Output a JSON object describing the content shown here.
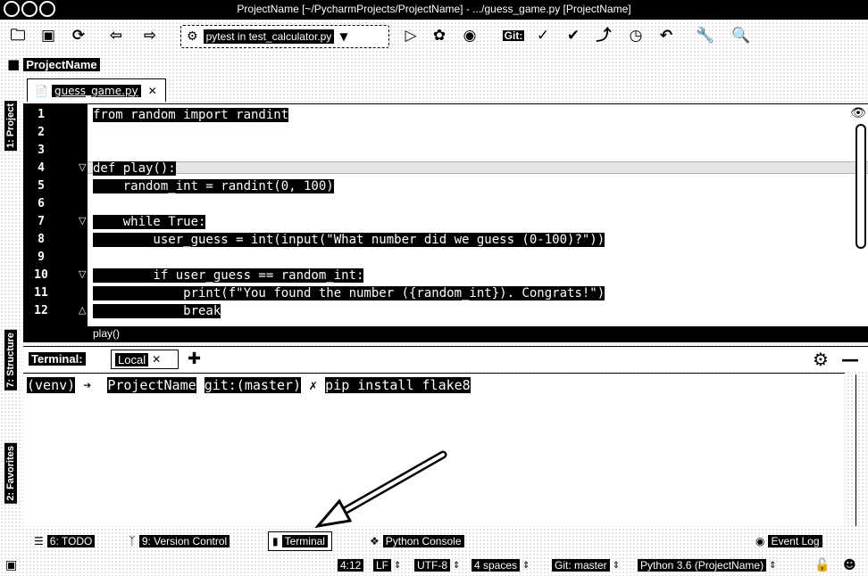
{
  "window": {
    "title": "ProjectName [~/PycharmProjects/ProjectName] - .../guess_game.py [ProjectName]"
  },
  "toolbar": {
    "run_config": "pytest in test_calculator.py",
    "vcs_label": "Git:"
  },
  "breadcrumb": {
    "project": "ProjectName"
  },
  "left_strip": {
    "project_tab": "1: Project",
    "structure_tab": "7: Structure",
    "favorites_tab": "2: Favorites"
  },
  "editor": {
    "tab_label": "guess_game.py",
    "line_numbers": [
      "1",
      "2",
      "3",
      "4",
      "5",
      "6",
      "7",
      "8",
      "9",
      "10",
      "11",
      "12"
    ],
    "lines": [
      "from random import randint",
      "",
      "",
      "def play():",
      "    random_int = randint(0, 100)",
      "",
      "    while True:",
      "        user_guess = int(input(\"What number did we guess (0-100)?\"))",
      "",
      "        if user_guess == random_int:",
      "            print(f\"You found the number ({random_int}). Congrats!\")",
      "            break"
    ],
    "scope": "play()"
  },
  "terminal": {
    "title": "Terminal:",
    "tab_label": "Local",
    "prompt_venv": "(venv)",
    "prompt_arrow": "➔",
    "prompt_dir": "ProjectName",
    "prompt_git": "git:(master)",
    "prompt_mark": "✗",
    "command": "pip install flake8"
  },
  "tool_tabs": {
    "todo": "6: TODO",
    "version_control": "9: Version Control",
    "terminal": "Terminal",
    "python_console": "Python Console",
    "event_log": "Event Log"
  },
  "status": {
    "position": "4:12",
    "line_sep": "LF",
    "encoding": "UTF-8",
    "indent": "4 spaces",
    "git": "Git: master",
    "interpreter": "Python 3.6 (ProjectName)"
  }
}
